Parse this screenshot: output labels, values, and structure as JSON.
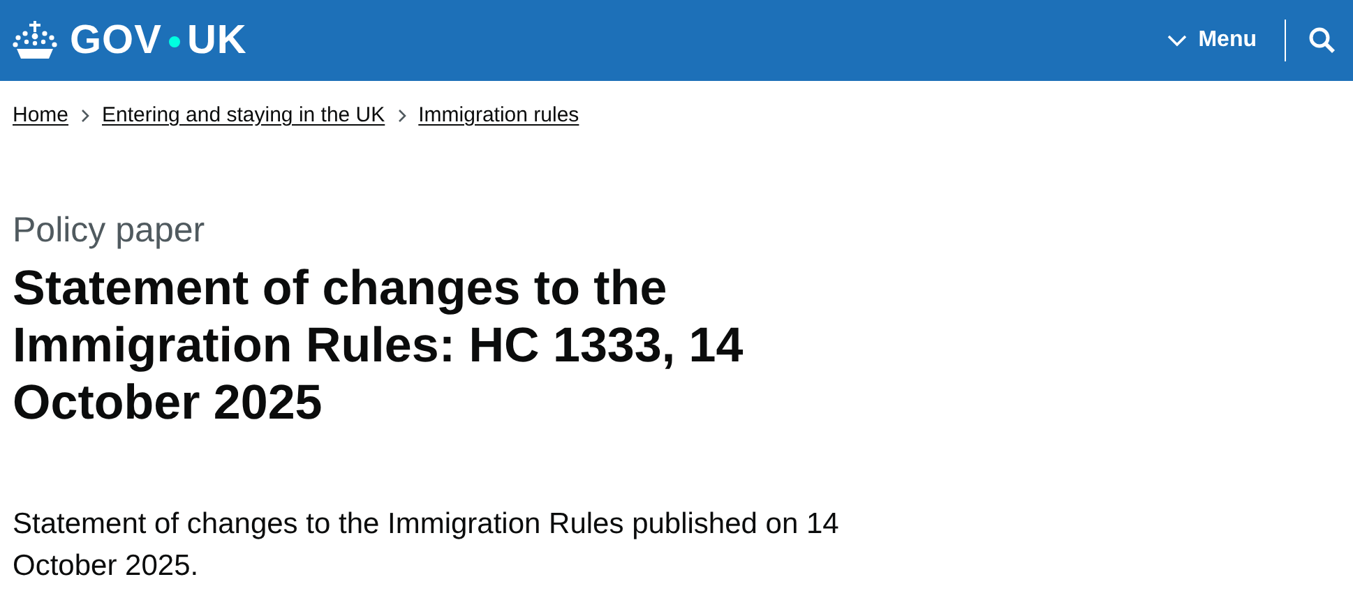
{
  "header": {
    "logo": {
      "left": "GOV",
      "right": "UK"
    },
    "menu_button": "Menu"
  },
  "breadcrumbs": [
    {
      "label": "Home"
    },
    {
      "label": "Entering and staying in the UK"
    },
    {
      "label": "Immigration rules"
    }
  ],
  "caption": "Policy paper",
  "title": "Statement of changes to the Immigration Rules: HC 1333, 14 October 2025",
  "lead": "Statement of changes to the Immigration Rules published on 14 October 2025."
}
